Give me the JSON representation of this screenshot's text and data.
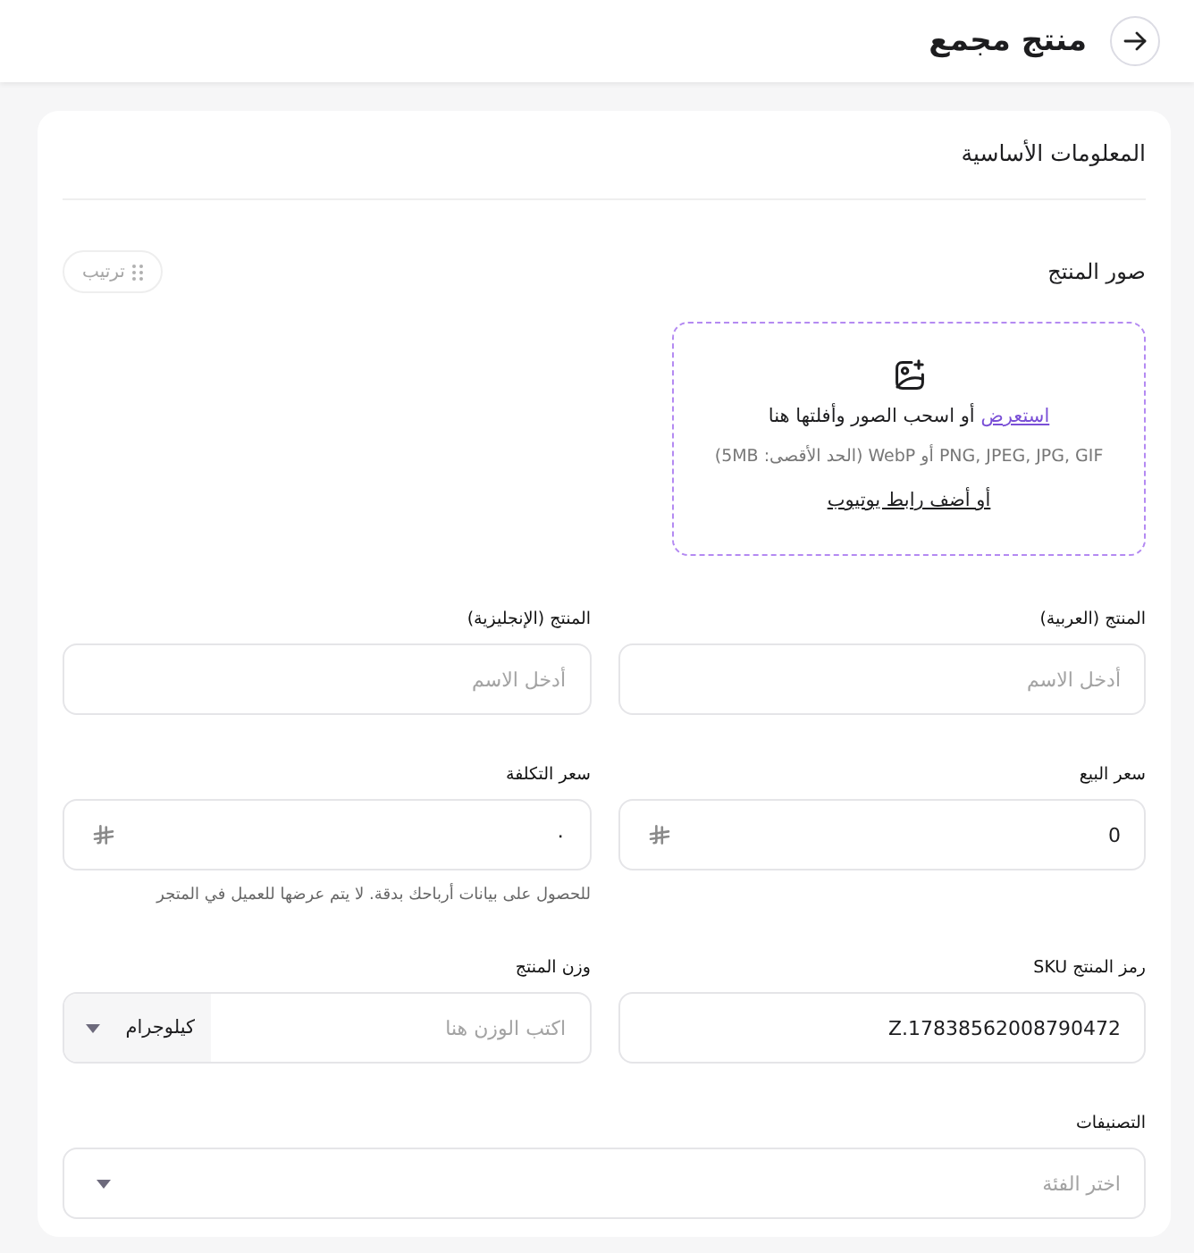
{
  "header": {
    "title": "منتج مجمع"
  },
  "card": {
    "title": "المعلومات الأساسية",
    "images": {
      "label": "صور المنتج",
      "sort_button": "ترتيب",
      "dropzone": {
        "browse_link": "استعرض",
        "drop_text": "أو اسحب الصور وأفلتها هنا",
        "formats": "PNG, JPEG, JPG, GIF أو WebP (الحد الأقصى: 5MB)",
        "youtube_link": "أو أضف رابط يوتيوب"
      }
    },
    "fields": [
      {
        "kind": "text",
        "label": "المنتج (العربية)",
        "placeholder": "أدخل الاسم"
      },
      {
        "kind": "text",
        "label": "المنتج (الإنجليزية)",
        "placeholder": "أدخل الاسم"
      },
      {
        "kind": "currency",
        "label": "سعر البيع",
        "value": "0"
      },
      {
        "kind": "currency",
        "label": "سعر التكلفة",
        "value": "٠",
        "hint": "للحصول على بيانات أرباحك بدقة. لا يتم عرضها للعميل في المتجر"
      },
      {
        "kind": "text",
        "label": "رمز المنتج SKU",
        "value": "Z.17838562008790472"
      },
      {
        "kind": "weight",
        "label": "وزن المنتج",
        "placeholder": "اكتب الوزن هنا",
        "unit": "كيلوجرام"
      },
      {
        "kind": "select",
        "label": "التصنيفات",
        "placeholder": "اختر الفئة"
      }
    ]
  }
}
